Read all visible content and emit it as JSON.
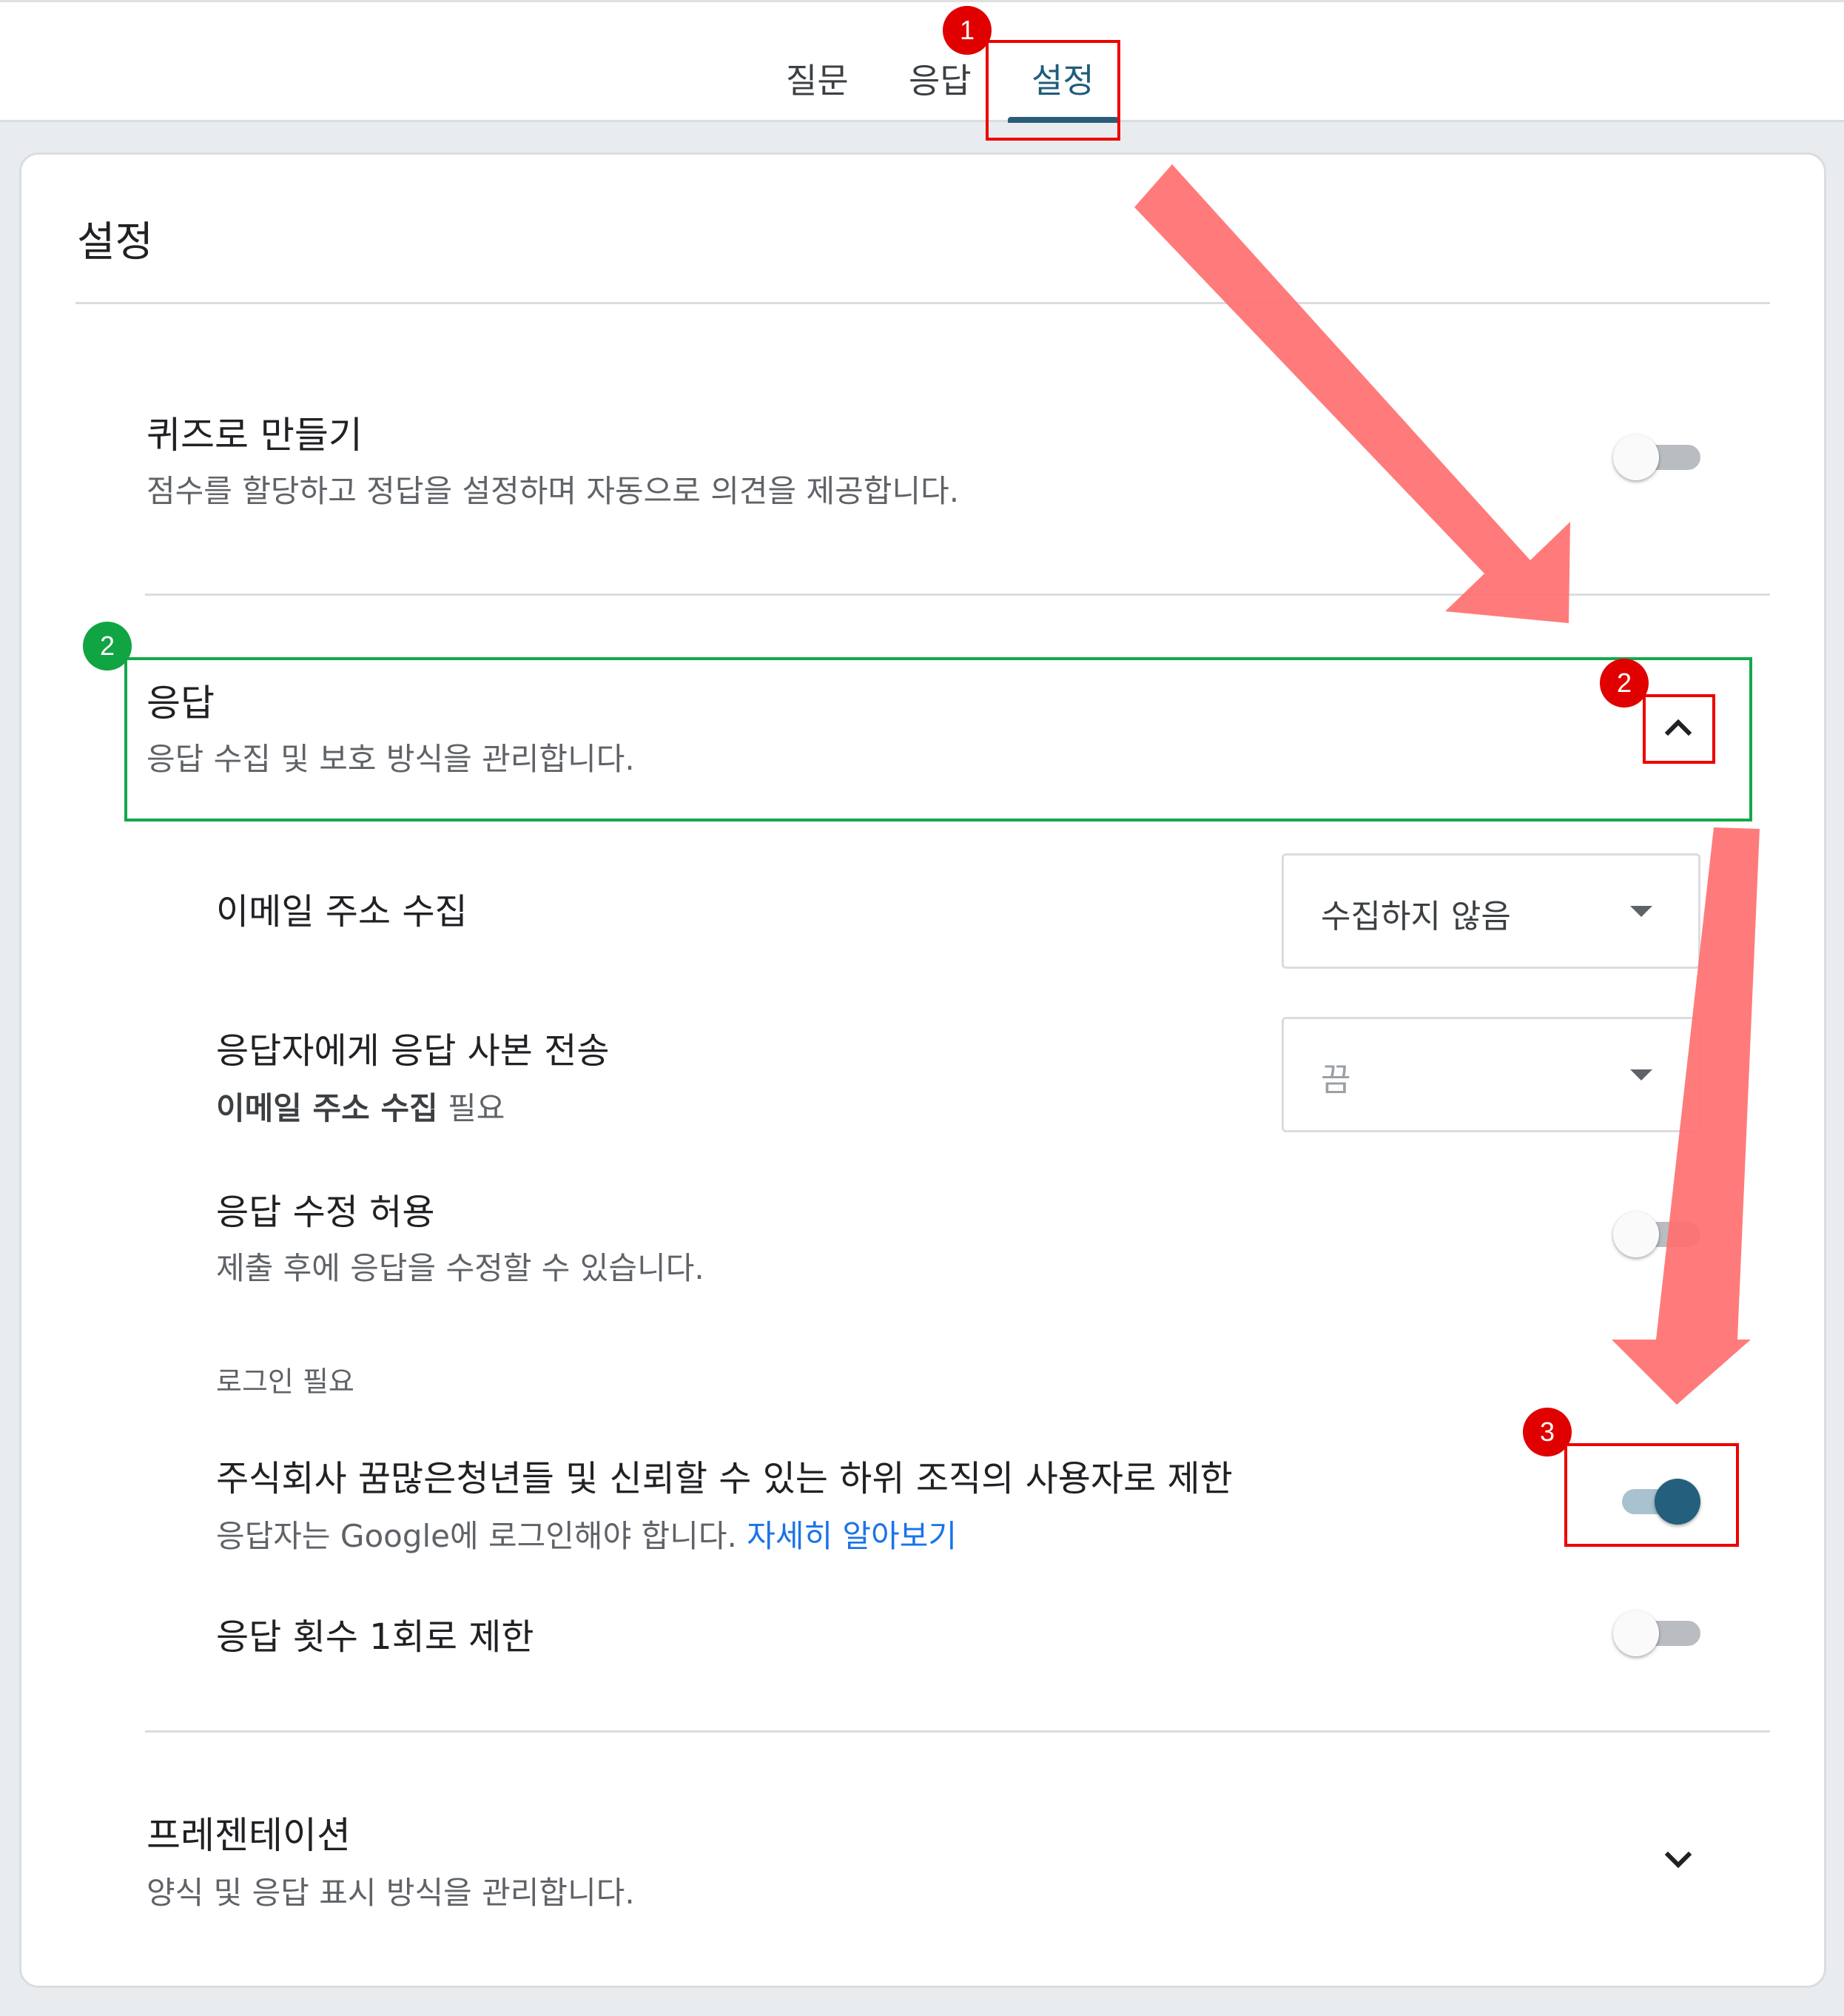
{
  "tabs": {
    "questions": "질문",
    "responses": "응답",
    "settings": "설정"
  },
  "card": {
    "title": "설정"
  },
  "quiz": {
    "title": "퀴즈로 만들기",
    "description": "점수를 할당하고 정답을 설정하며 자동으로 의견을 제공합니다.",
    "enabled": false
  },
  "responses_section": {
    "title": "응답",
    "description": "응답 수집 및 보호 방식을 관리합니다.",
    "expanded": true,
    "collect_email": {
      "label": "이메일 주소 수집",
      "value": "수집하지 않음"
    },
    "send_copy": {
      "label": "응답자에게 응답 사본 전송",
      "note_bold": "이메일 주소 수집",
      "note_rest": " 필요",
      "value": "끔"
    },
    "allow_edit": {
      "label": "응답 수정 허용",
      "description": "제출 후에 응답을 수정할 수 있습니다.",
      "enabled": false
    },
    "login_required": {
      "caption": "로그인 필요",
      "restrict_label": "주식회사 꿈많은청년들 및 신뢰할 수 있는 하위 조직의 사용자로 제한",
      "restrict_description": "응답자는 Google에 로그인해야 합니다. ",
      "learn_more": "자세히 알아보기",
      "restrict_enabled": true
    },
    "limit_one": {
      "label": "응답 횟수 1회로 제한",
      "enabled": false
    }
  },
  "presentation": {
    "title": "프레젠테이션",
    "description": "양식 및 응답 표시 방식을 관리합니다.",
    "expanded": false
  },
  "annotations": {
    "badge1": "1",
    "badge2_green": "2",
    "badge2_red": "2",
    "badge3": "3",
    "colors": {
      "red": "#e00000",
      "green": "#11a442",
      "arrow": "#ff7070",
      "accent": "#24607e"
    }
  }
}
